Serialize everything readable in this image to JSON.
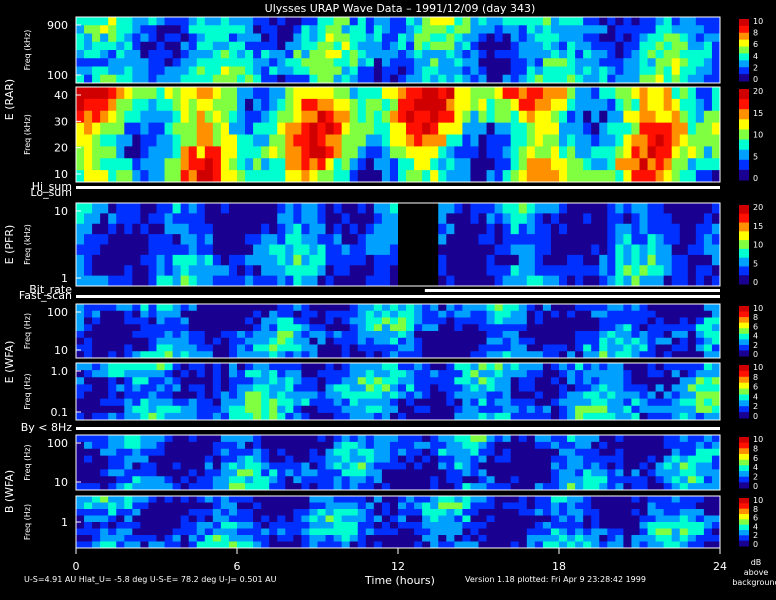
{
  "title": "Ulysses URAP Wave Data – 1991/12/09  (day 343)",
  "footer": {
    "orbit_info": "U-S=4.91 AU   Hlat_U= -5.8 deg   U-S-E= 78.2 deg   U-J= 0.501 AU",
    "version": "Version 1.18 plotted: Fri Apr  9 23:28:42 1999",
    "colorbar_unit": [
      "dB",
      "above",
      "background"
    ]
  },
  "chart_data": {
    "type": "heatmap",
    "title": "Ulysses URAP Wave Data – 1991/12/09  (day 343)",
    "xlabel": "Time (hours)",
    "x_ticks": [
      "0",
      "6",
      "12",
      "18",
      "24"
    ],
    "xlim": [
      0,
      24
    ],
    "grid": false,
    "colormap": [
      "#000000",
      "#1a0090",
      "#0030ff",
      "#00a0ff",
      "#00ffd0",
      "#80ff40",
      "#ffff00",
      "#ff9000",
      "#ff1000",
      "#d00000"
    ],
    "panels": [
      {
        "id": "E (RAR)",
        "ylabel": "Freq (kHz)",
        "scale": "log",
        "ylim": [
          52,
          940
        ],
        "y_ticks": [
          "900",
          "100"
        ],
        "zrange": [
          0,
          10
        ],
        "z_ticks": [
          "10",
          "8",
          "6",
          "4",
          "2",
          "0"
        ],
        "intensity": "mixed"
      },
      {
        "id": "E (RAR)",
        "ylabel": "Freq (kHz)",
        "scale": "linear",
        "ylim": [
          1,
          48
        ],
        "y_ticks": [
          "40",
          "30",
          "20",
          "10"
        ],
        "zrange": [
          0,
          20
        ],
        "z_ticks": [
          "20",
          "15",
          "10",
          "5",
          "0"
        ],
        "intensity": "high"
      },
      {
        "id": "E (PFR)",
        "ylabel": "Freq (kHz)",
        "scale": "log",
        "ylim": [
          0.6,
          25
        ],
        "y_ticks": [
          "10",
          "1"
        ],
        "zrange": [
          0,
          20
        ],
        "z_ticks": [
          "20",
          "15",
          "10",
          "5",
          "0"
        ],
        "intensity": "low",
        "data_gap_hours": [
          12.0,
          13.4
        ]
      },
      {
        "id": "E (WFA)",
        "ylabel": "Freq (Hz)",
        "scale": "log",
        "ylim": [
          9,
          400
        ],
        "y_ticks": [
          "100",
          "10"
        ],
        "zrange": [
          0,
          10
        ],
        "z_ticks": [
          "10",
          "8",
          "6",
          "4",
          "2",
          "0"
        ],
        "intensity": "low"
      },
      {
        "id": "E (WFA)",
        "ylabel": "Freq (Hz)",
        "scale": "log",
        "ylim": [
          0.07,
          3
        ],
        "y_ticks": [
          "1.0",
          "0.1"
        ],
        "zrange": [
          0,
          10
        ],
        "z_ticks": [
          "10",
          "8",
          "6",
          "4",
          "2",
          "0"
        ],
        "intensity": "mid"
      },
      {
        "id": "B (WFA)",
        "ylabel": "Freq (Hz)",
        "scale": "log",
        "ylim": [
          8,
          400
        ],
        "y_ticks": [
          "100",
          "10"
        ],
        "zrange": [
          0,
          10
        ],
        "z_ticks": [
          "10",
          "8",
          "6",
          "4",
          "2",
          "0"
        ],
        "intensity": "low"
      },
      {
        "id": "B (WFA)",
        "ylabel": "Freq (Hz)",
        "scale": "log",
        "ylim": [
          0.1,
          6
        ],
        "y_ticks": [
          "1"
        ],
        "zrange": [
          0,
          10
        ],
        "z_ticks": [
          "10",
          "8",
          "6",
          "4",
          "2",
          "0"
        ],
        "intensity": "low"
      }
    ],
    "mode_bars": [
      {
        "label": "Hi_sum",
        "on_hours": [
          [
            0,
            24
          ]
        ]
      },
      {
        "label": "Lo_sum",
        "on_hours": []
      },
      {
        "label": "Bit_rate",
        "on_hours": [
          [
            13.0,
            24
          ]
        ]
      },
      {
        "label": "Fast_scan",
        "on_hours": [
          [
            0,
            24
          ]
        ]
      },
      {
        "label": "By < 8Hz",
        "on_hours": [
          [
            0,
            24
          ]
        ]
      }
    ],
    "panel_labels": [
      "E (RAR)",
      "E (PFR)",
      "E (WFA)",
      "B (WFA)"
    ]
  }
}
